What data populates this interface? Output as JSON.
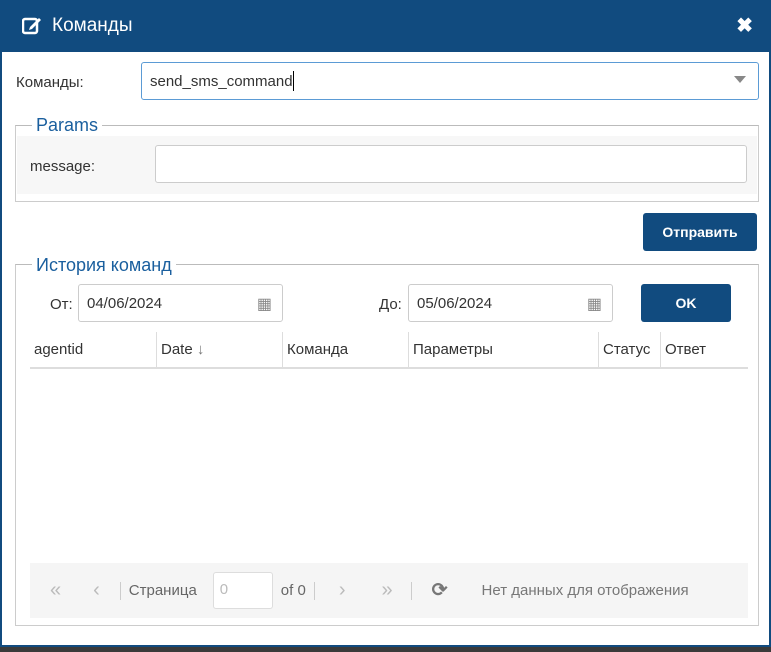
{
  "dialog": {
    "title": "Команды",
    "close_icon": "close-icon",
    "edit_icon": "edit-icon"
  },
  "command": {
    "label": "Команды:",
    "value": "send_sms_command"
  },
  "params": {
    "legend": "Params",
    "message_label": "message:",
    "message_value": ""
  },
  "send_button": "Отправить",
  "history": {
    "legend": "История команд",
    "from_label": "От:",
    "from_value": "04/06/2024",
    "to_label": "До:",
    "to_value": "05/06/2024",
    "ok_button": "OK"
  },
  "grid": {
    "columns": [
      "agentid",
      "Date",
      "Команда",
      "Параметры",
      "Статус",
      "Ответ"
    ],
    "rows": []
  },
  "pager": {
    "page_label": "Страница",
    "page_value": "0",
    "of_label": "of 0",
    "empty_text": "Нет данных для отображения"
  },
  "colors": {
    "primary": "#114b7f",
    "legend": "#1a5f9e"
  }
}
